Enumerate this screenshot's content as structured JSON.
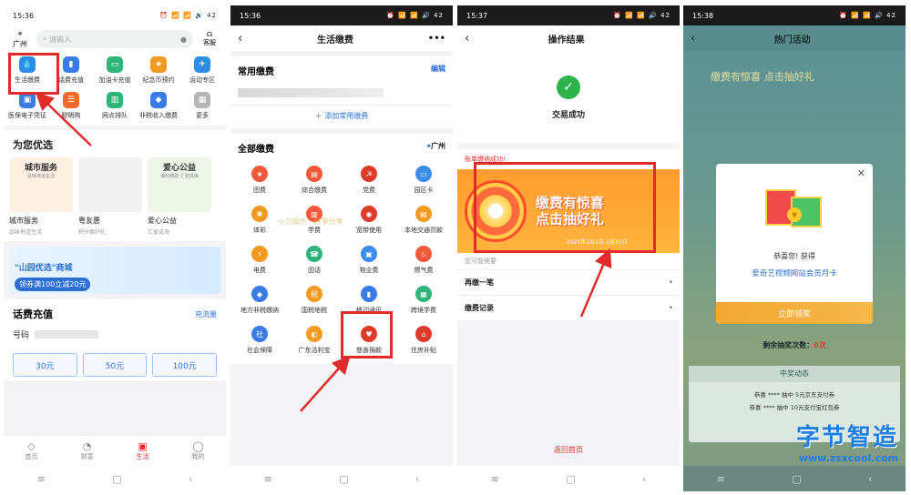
{
  "panel1": {
    "time": "15:36",
    "status_icons": "⏰ 📶 📶 🔊 42",
    "location": "广州",
    "search_placeholder": "请输入",
    "service_label": "客服",
    "grid": [
      {
        "label": "生活缴费",
        "color": "#2b8de6",
        "icon": "💧"
      },
      {
        "label": "话费充值",
        "color": "#3b7be8",
        "icon": "▮"
      },
      {
        "label": "加油卡充值",
        "color": "#2fb57a",
        "icon": "▭"
      },
      {
        "label": "纪念币预约",
        "color": "#f39b20",
        "icon": "★"
      },
      {
        "label": "运动专区",
        "color": "#2b8de6",
        "icon": "✈"
      },
      {
        "label": "医保电子凭证",
        "color": "#3b7be8",
        "icon": "▣"
      },
      {
        "label": "聪明购",
        "color": "#f26a2b",
        "icon": "☰"
      },
      {
        "label": "网点排队",
        "color": "#2fb57a",
        "icon": "▥"
      },
      {
        "label": "非税收入缴费",
        "color": "#3b7be8",
        "icon": "◆"
      },
      {
        "label": "更多",
        "color": "#b5b5b5",
        "icon": "▦"
      }
    ],
    "section_title": "为您优选",
    "youxuan": [
      {
        "banner": "城市服务",
        "banner_sub": "品味地道生活",
        "name": "城市服务",
        "sub": "品味地道生活",
        "color": "#fdf1e4"
      },
      {
        "banner": "",
        "banner_sub": "",
        "name": "粤友惠",
        "sub": "积分换好礼",
        "color": "#f1f1f1"
      },
      {
        "banner": "爱心公益",
        "banner_sub": "爆科救助 汇爱成海",
        "name": "爱心公益",
        "sub": "汇爱成海",
        "color": "#eef6ea"
      }
    ],
    "ad_title": "\"山园优选\"商城",
    "ad_button": "领券满100立减20元",
    "recharge_title": "话费充值",
    "recharge_link": "充流量",
    "number_label": "号码",
    "amounts": [
      "30元",
      "50元",
      "100元"
    ],
    "tabs": [
      {
        "label": "首页",
        "icon": "◇"
      },
      {
        "label": "财富",
        "icon": "◔"
      },
      {
        "label": "生活",
        "icon": "▣"
      },
      {
        "label": "我的",
        "icon": "◯"
      }
    ]
  },
  "panel2": {
    "time": "15:36",
    "title": "生活缴费",
    "common_title": "常用缴费",
    "edit_label": "编辑",
    "add_label": "＋ 添加常用缴费",
    "all_title": "全部缴费",
    "city": "广州",
    "watermark": "小刀娱乐 · 好享分享",
    "grid": [
      {
        "label": "团费",
        "color": "#f05a3a",
        "icon": "★"
      },
      {
        "label": "综合缴费",
        "color": "#f05a3a",
        "icon": "▤"
      },
      {
        "label": "党费",
        "color": "#e03a2a",
        "icon": "☭"
      },
      {
        "label": "园区卡",
        "color": "#3b8be8",
        "icon": "▭"
      },
      {
        "label": "体彩",
        "color": "#f39b20",
        "icon": "✱"
      },
      {
        "label": "学费",
        "color": "#f05a3a",
        "icon": "▥"
      },
      {
        "label": "宽带使用",
        "color": "#e03a2a",
        "icon": "◉"
      },
      {
        "label": "本地交通罚款",
        "color": "#f39b20",
        "icon": "▤"
      },
      {
        "label": "电费",
        "color": "#f39b20",
        "icon": "⚡"
      },
      {
        "label": "固话",
        "color": "#2fb57a",
        "icon": "☎"
      },
      {
        "label": "物业费",
        "color": "#3b8be8",
        "icon": "▣"
      },
      {
        "label": "燃气费",
        "color": "#f05a3a",
        "icon": "♨"
      },
      {
        "label": "地方非税缴纳",
        "color": "#3b7be8",
        "icon": "◆"
      },
      {
        "label": "国税地税",
        "color": "#f39b20",
        "icon": "税"
      },
      {
        "label": "移动通讯",
        "color": "#3b7be8",
        "icon": "▮"
      },
      {
        "label": "跨境学费",
        "color": "#2fb57a",
        "icon": "▦"
      },
      {
        "label": "社会保障",
        "color": "#3b7be8",
        "icon": "社"
      },
      {
        "label": "广东活利宝",
        "color": "#f39b20",
        "icon": "◐"
      },
      {
        "label": "慈善捐款",
        "color": "#e03a2a",
        "icon": "♥"
      },
      {
        "label": "住房补贴",
        "color": "#e03a2a",
        "icon": "⌂"
      }
    ]
  },
  "panel3": {
    "time": "15:37",
    "title": "操作结果",
    "result": "交易成功",
    "notice": "账单缴纳成功!",
    "promo_line1": "缴费有惊喜",
    "promo_line2": "点击抽好礼",
    "promo_date": "2021年1月1日-1月31日",
    "sub": "您可能需要",
    "rows": [
      "再缴一笔",
      "缴费记录"
    ],
    "home": "返回首页"
  },
  "panel4": {
    "time": "15:38",
    "title": "热门活动",
    "sky_text": "缴费有惊喜 点击抽好礼",
    "congrats": "恭喜您! 获得",
    "prize": "爱奇艺视频网站会员月卡",
    "claim": "立即领奖",
    "remain_label": "剩余抽奖次数：",
    "remain_value": "0次",
    "win_title": "中奖动态",
    "win_rows": [
      "恭喜 **** 抽中 5元京东支付券",
      "恭喜 **** 抽中 10元支付宝红包券"
    ],
    "brand_cn": "字节智造",
    "brand_en": "www.zsxcool.com"
  }
}
